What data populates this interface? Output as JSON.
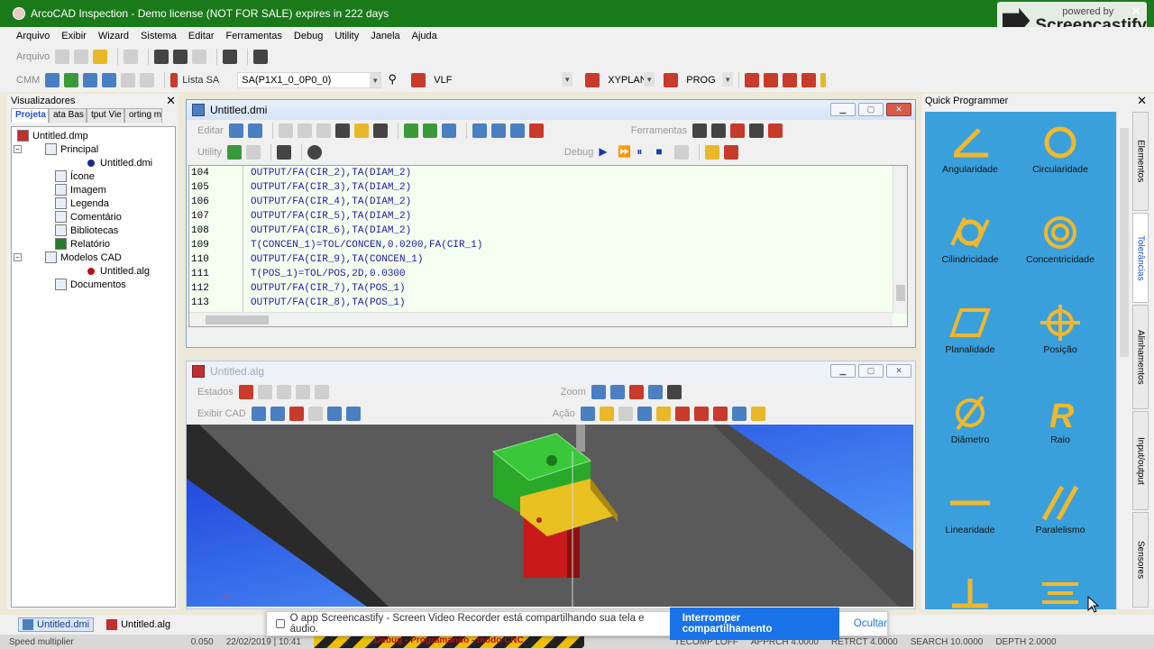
{
  "title_bar": {
    "text": "ArcoCAD Inspection - Demo license (NOT FOR SALE) expires in 222 days"
  },
  "watermark": {
    "small": "powered by",
    "big": "Screencastify"
  },
  "menu": [
    "Arquivo",
    "Exibir",
    "Wizard",
    "Sistema",
    "Editar",
    "Ferramentas",
    "Debug",
    "Utility",
    "Janela",
    "Ajuda"
  ],
  "toolbar1": {
    "arquivo_label": "Arquivo"
  },
  "toolbar2": {
    "cmm_label": "CMM",
    "lista_sa_label": "Lista SA",
    "sa_combo": "SA(P1X1_0_0P0_0)",
    "vlf_combo": "VLF",
    "xyplan_combo": "XYPLAN",
    "prog_combo": "PROG"
  },
  "left_panel": {
    "title": "Visualizadores",
    "tabs": [
      "Projeta",
      "ata Bas",
      "tput Vie",
      "orting mo"
    ],
    "tree": [
      "Untitled.dmp",
      "Principal",
      "Untitled.dmi",
      "Ícone",
      "Imagem",
      "Legenda",
      "Comentário",
      "Bibliotecas",
      "Relatório",
      "Modelos CAD",
      "Untitled.alg",
      "Documentos"
    ]
  },
  "dmi_window": {
    "title": "Untitled.dmi",
    "editar_label": "Editar",
    "ferramentas_label": "Ferramentas",
    "utility_label": "Utility",
    "debug_label": "Debug",
    "lines": [
      {
        "num": "104",
        "text": "OUTPUT/FA(CIR_2),TA(DIAM_2)"
      },
      {
        "num": "105",
        "text": "OUTPUT/FA(CIR_3),TA(DIAM_2)"
      },
      {
        "num": "106",
        "text": "OUTPUT/FA(CIR_4),TA(DIAM_2)"
      },
      {
        "num": "107",
        "text": "OUTPUT/FA(CIR_5),TA(DIAM_2)"
      },
      {
        "num": "108",
        "text": "OUTPUT/FA(CIR_6),TA(DIAM_2)"
      },
      {
        "num": "109",
        "text": "T(CONCEN_1)=TOL/CONCEN,0.0200,FA(CIR_1)"
      },
      {
        "num": "110",
        "text": "OUTPUT/FA(CIR_9),TA(CONCEN_1)"
      },
      {
        "num": "111",
        "text": "T(POS_1)=TOL/POS,2D,0.0300"
      },
      {
        "num": "112",
        "text": "OUTPUT/FA(CIR_7),TA(POS_1)"
      },
      {
        "num": "113",
        "text": "OUTPUT/FA(CIR_8),TA(POS_1)"
      },
      {
        "num": "114",
        "text": ""
      }
    ]
  },
  "alg_window": {
    "title": "Untitled.alg",
    "estados_label": "Estados",
    "zoom_label": "Zoom",
    "exibir_cad_label": "Exibir CAD",
    "acao_label": "Ação"
  },
  "quick_programmer": {
    "title": "Quick Programmer",
    "items": [
      {
        "label": "Angularidade",
        "icon": "angularity-icon"
      },
      {
        "label": "Circularidade",
        "icon": "circularity-icon"
      },
      {
        "label": "Cilindricidade",
        "icon": "cylindricity-icon"
      },
      {
        "label": "Concentricidade",
        "icon": "concentricity-icon"
      },
      {
        "label": "Planalidade",
        "icon": "flatness-icon"
      },
      {
        "label": "Posição",
        "icon": "position-icon"
      },
      {
        "label": "Diâmetro",
        "icon": "diameter-icon"
      },
      {
        "label": "Raio",
        "icon": "radius-icon"
      },
      {
        "label": "Linearidade",
        "icon": "straightness-icon"
      },
      {
        "label": "Paralelismo",
        "icon": "parallelism-icon"
      },
      {
        "label": "",
        "icon": "perpendicularity-icon"
      },
      {
        "label": "",
        "icon": "symmetry-icon"
      }
    ],
    "vertical_tabs": [
      "Elementos",
      "Tolerâncias",
      "Alinhamentos",
      "Input/output",
      "Sensores"
    ]
  },
  "taskbar": {
    "items": [
      "Untitled.dmi",
      "Untitled.alg"
    ]
  },
  "notification": {
    "text": "O app Screencastify - Screen Video Recorder está compartilhando sua tela e áudio.",
    "stop_button": "Interromper compartilhamento",
    "hide_button": "Ocultar"
  },
  "status_bar": {
    "speed": "Speed multiplier",
    "value": "0.050",
    "datetime": "22/02/2019 | 10:41",
    "warning": "Debug - Programando - modo CNC",
    "tecomp": "TECOMP  LOFF",
    "apprch": "APPRCH  4.0000",
    "retrct": "RETRCT  4.0000",
    "search": "SEARCH  10.0000",
    "depth": "DEPTH  2.0000"
  },
  "colors": {
    "titlebar": "#1a7a1a",
    "qp_bg": "#3aa0dc",
    "icon_gold": "#f2b82a",
    "code_bg": "#f5fff0"
  }
}
